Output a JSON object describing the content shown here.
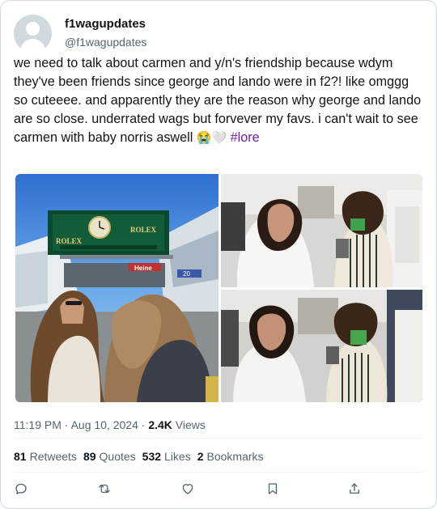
{
  "author": {
    "display_name": "f1wagupdates",
    "handle": "@f1wagupdates"
  },
  "tweet": {
    "text": "we need to talk about carmen and y/n's friendship because wdym they've been friends since george and lando were in f2?! like omggg so cuteeee. and apparently they are the reason why george and lando are so close. underrated wags but forvever my favs. i can't wait to see carmen with baby norris aswell ",
    "emojis": "😭🤍",
    "hashtag": "#lore"
  },
  "media": {
    "sign_brand": "ROLEX",
    "sign_brand_right": "ROLEX",
    "banner_text": "Heine",
    "gate_number": "20"
  },
  "meta": {
    "time": "11:19 PM",
    "separator": "·",
    "date": "Aug 10, 2024",
    "views_count": "2.4K",
    "views_label": "Views"
  },
  "stats": [
    {
      "count": "81",
      "label": "Retweets"
    },
    {
      "count": "89",
      "label": "Quotes"
    },
    {
      "count": "532",
      "label": "Likes"
    },
    {
      "count": "2",
      "label": "Bookmarks"
    }
  ],
  "actions": [
    {
      "icon": "reply-icon"
    },
    {
      "icon": "retweet-icon"
    },
    {
      "icon": "like-icon"
    },
    {
      "icon": "bookmark-icon"
    },
    {
      "icon": "share-icon"
    }
  ],
  "colors": {
    "text": "#0f1419",
    "secondary": "#536471",
    "hashtag": "#6f1ea8",
    "border": "#cfd9de"
  }
}
